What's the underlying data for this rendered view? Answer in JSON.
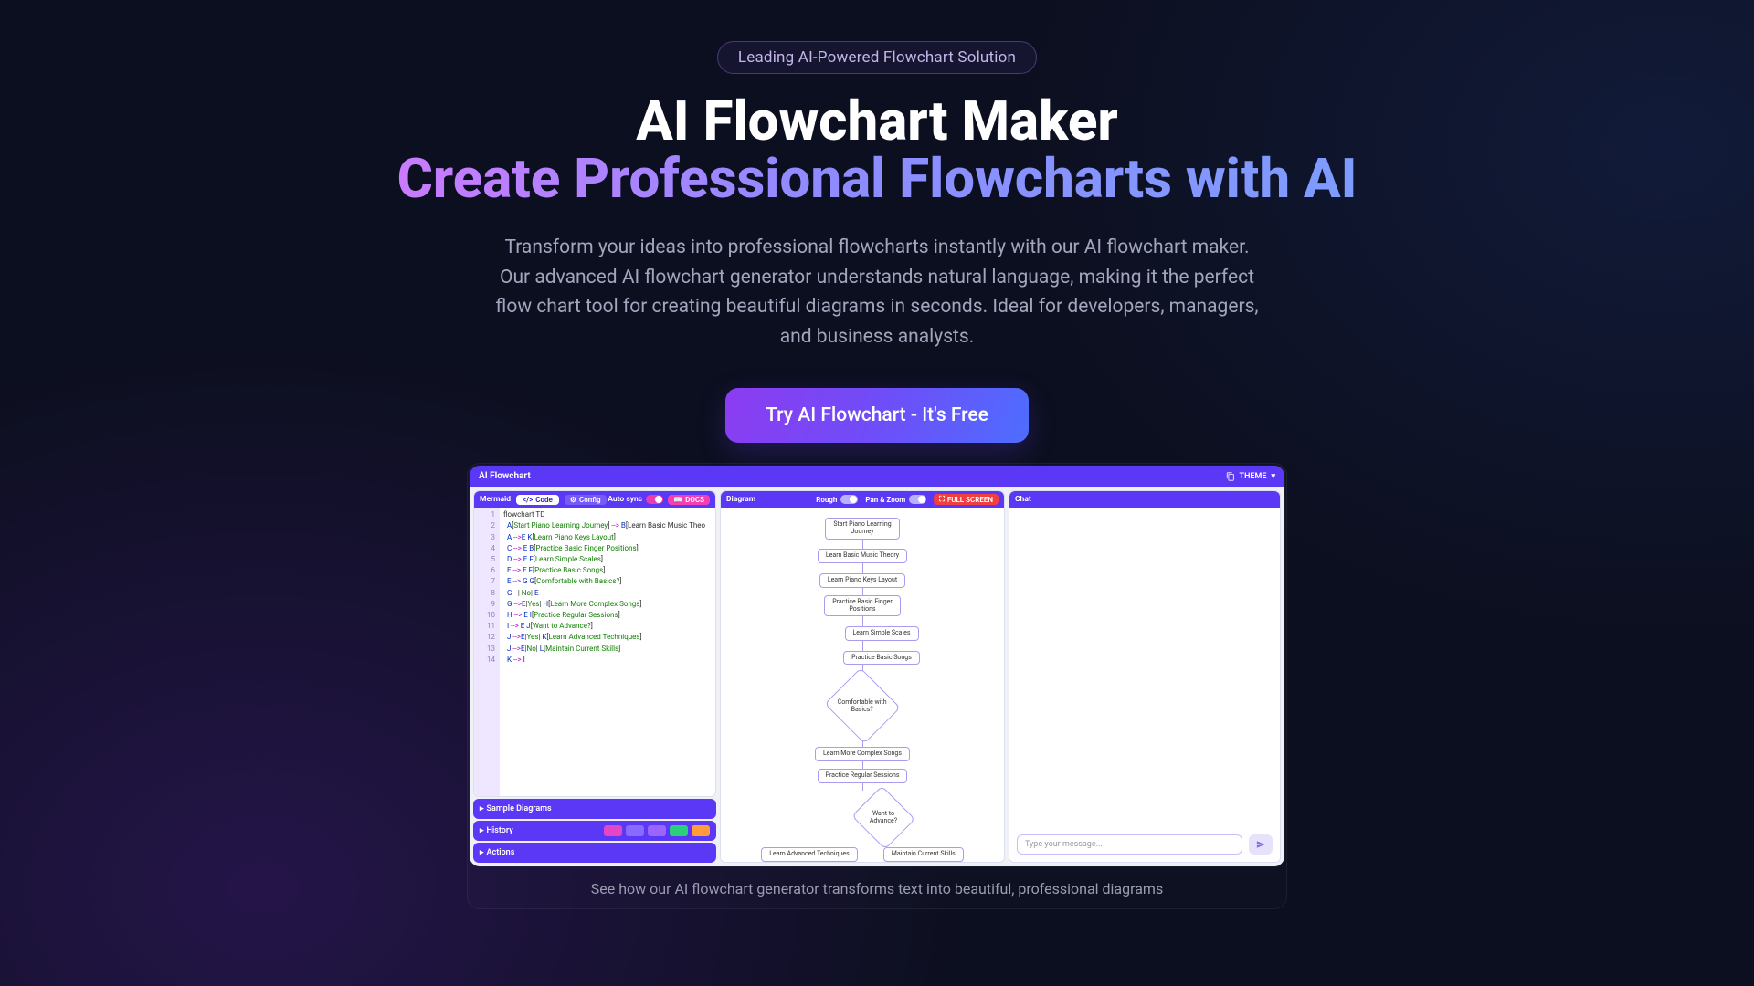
{
  "badge": "Leading AI-Powered Flowchart Solution",
  "title_line1": "AI Flowchart Maker",
  "title_line2": "Create Professional Flowcharts with AI",
  "description": "Transform your ideas into professional flowcharts instantly with our AI flowchart maker. Our advanced AI flowchart generator understands natural language, making it the perfect flow chart tool for creating beautiful diagrams in seconds. Ideal for developers, managers, and business analysts.",
  "cta_label": "Try AI Flowchart - It's Free",
  "caption": "See how our AI flowchart generator transforms text into beautiful, professional diagrams",
  "app": {
    "title": "AI Flowchart",
    "theme_label": "THEME",
    "left": {
      "header": "Mermaid",
      "tabs": {
        "code": "Code",
        "config": "Config"
      },
      "auto_sync": "Auto sync",
      "docs": "DOCS",
      "code_lines": [
        "flowchart TD",
        "  A[Start Piano Learning Journey] --> B[Learn Basic Music Theo",
        "  A -->E K[Learn Piano Keys Layout]",
        "  C --> E B[Practice Basic Finger Positions]",
        "  D --> E F[Learn Simple Scales]",
        "  E --> E F[Practice Basic Songs]",
        "  E --> G G[Comfortable with Basics?]",
        "  G --| No| E",
        "  G -->E|Yes| H[Learn More Complex Songs]",
        "  H --> E I[Practice Regular Sessions]",
        "  I --> E J[Want to Advance?]",
        "  J -->E|Yes| K[Learn Advanced Techniques]",
        "  J -->E|No| L[Maintain Current Skills]",
        "  K --> I"
      ],
      "panel_sample": "Sample Diagrams",
      "panel_history": "History",
      "panel_actions": "Actions"
    },
    "middle": {
      "header": "Diagram",
      "rough": "Rough",
      "pan_zoom": "Pan & Zoom",
      "full_screen": "FULL SCREEN",
      "nodes": {
        "start": "Start Piano Learning\nJourney",
        "theory": "Learn Basic Music Theory",
        "keys": "Learn Piano Keys Layout",
        "finger": "Practice Basic Finger\nPositions",
        "scales": "Learn Simple Scales",
        "basicsongs": "Practice Basic Songs",
        "comfortable": "Comfortable with Basics?",
        "complex": "Learn More Complex Songs",
        "regular": "Practice Regular Sessions",
        "advance": "Want to Advance?",
        "adv": "Learn Advanced Techniques",
        "maintain": "Maintain Current Skills"
      }
    },
    "right": {
      "header": "Chat",
      "placeholder": "Type your message..."
    }
  }
}
